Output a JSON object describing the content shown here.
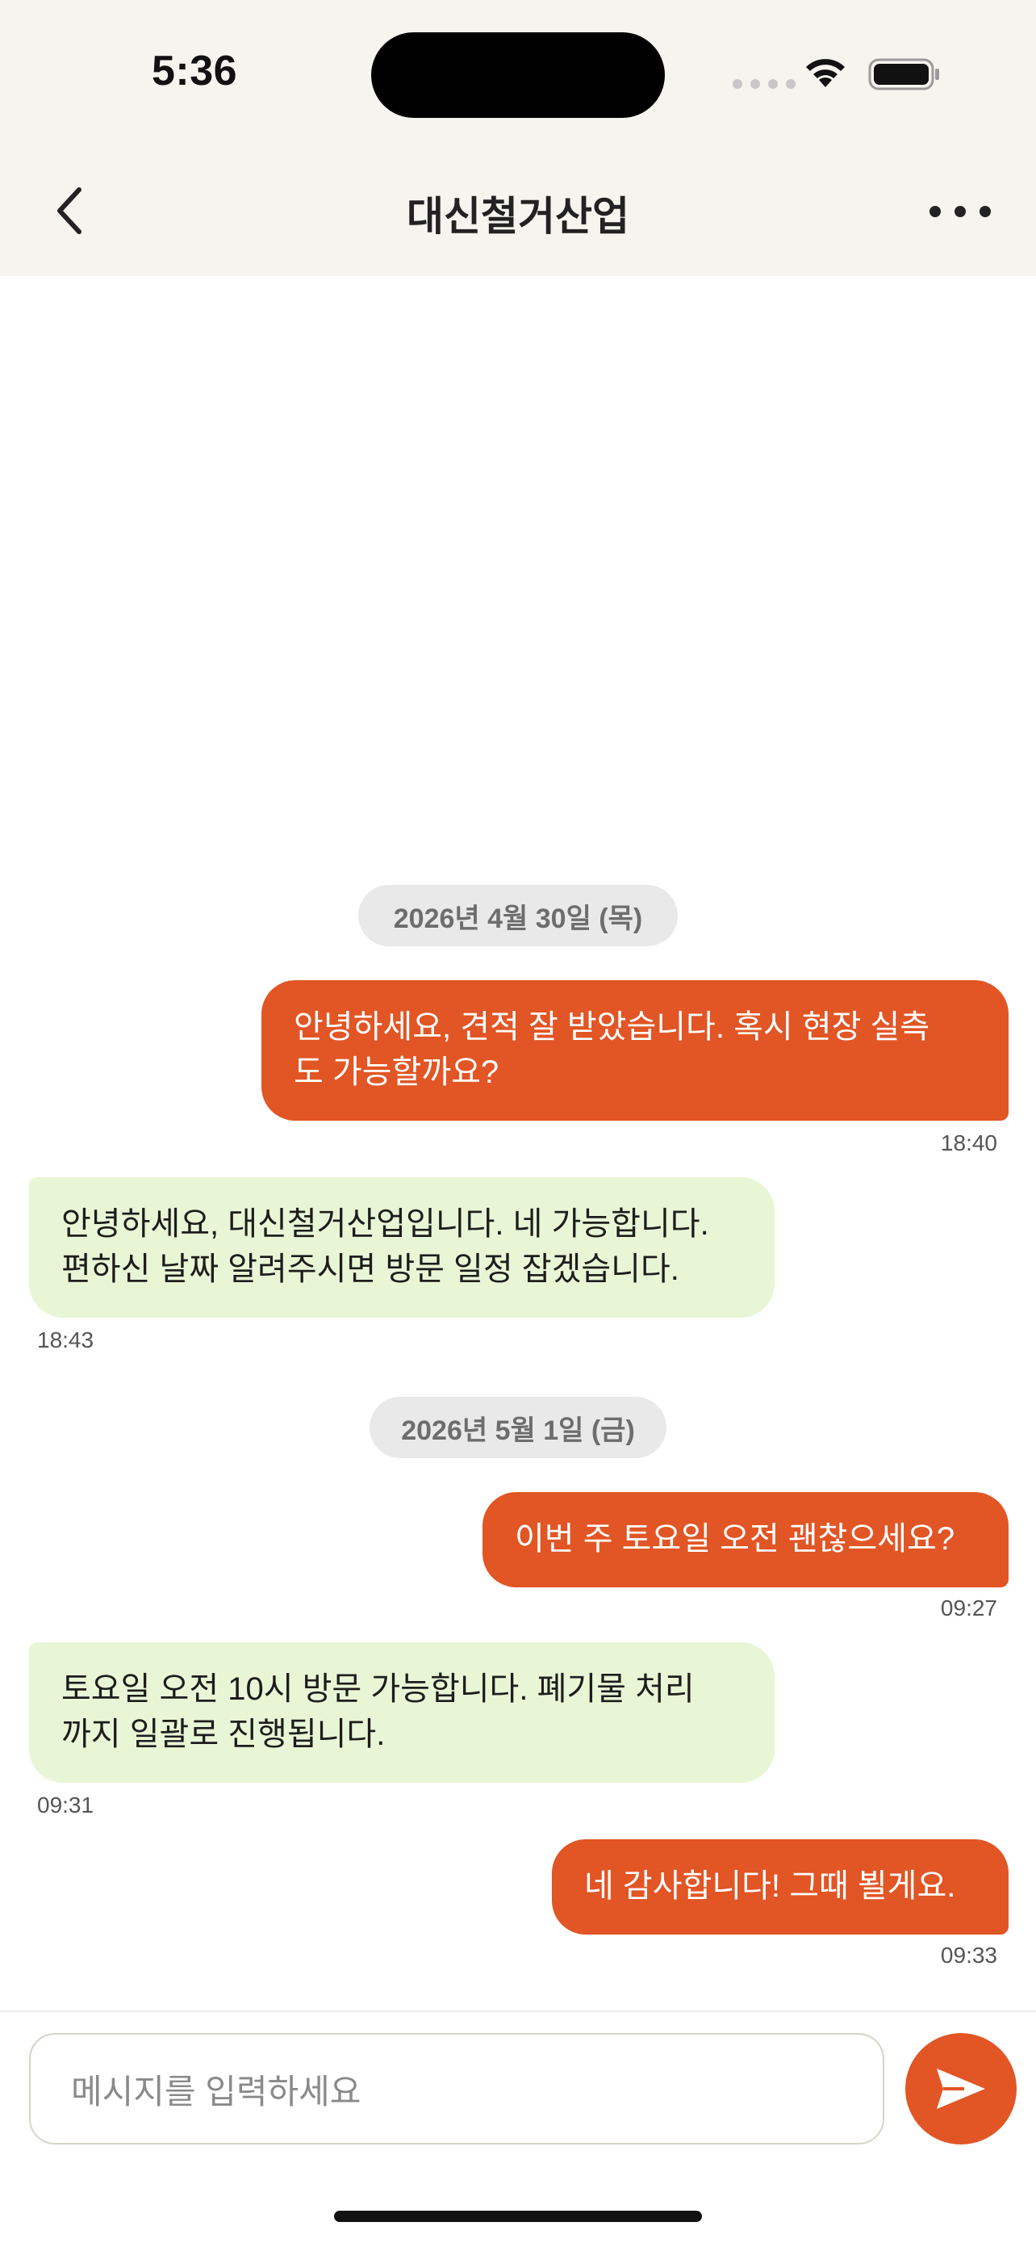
{
  "status": {
    "time": "5:36"
  },
  "header": {
    "title": "대신철거산업"
  },
  "messages": [
    {
      "type": "date",
      "text": "2026년 4월 30일 (목)"
    },
    {
      "type": "out",
      "text": "안녕하세요, 견적 잘 받았습니다. 혹시 현장 실측도 가능할까요?",
      "lines": [
        "안녕하세요, 견적 잘 받았습니다. 혹시 현장 실측",
        "도 가능할까요?"
      ],
      "time": "18:40"
    },
    {
      "type": "in",
      "lines": [
        "안녕하세요, 대신철거산업입니다. 네 가능합니다.",
        "편하신 날짜 알려주시면 방문 일정 잡겠습니다."
      ],
      "time": "18:43"
    },
    {
      "type": "date",
      "text": "2026년 5월 1일 (금)"
    },
    {
      "type": "out",
      "lines": [
        "이번 주 토요일 오전 괜찮으세요?"
      ],
      "time": "09:27"
    },
    {
      "type": "in",
      "lines": [
        "토요일 오전 10시 방문 가능합니다. 폐기물 처리",
        "까지 일괄로 진행됩니다."
      ],
      "time": "09:31"
    },
    {
      "type": "out",
      "lines": [
        "네 감사합니다! 그때 뵐게요."
      ],
      "time": "09:33"
    }
  ],
  "composer": {
    "placeholder": "메시지를 입력하세요"
  },
  "colors": {
    "accent": "#e25525",
    "incoming_bubble": "#e9f6d6",
    "header_bg": "#f6f4ef"
  },
  "icons": {
    "back": "chevron-left-icon",
    "more": "ellipsis-icon",
    "send": "paper-plane-icon",
    "wifi": "wifi-icon",
    "battery": "battery-icon"
  }
}
